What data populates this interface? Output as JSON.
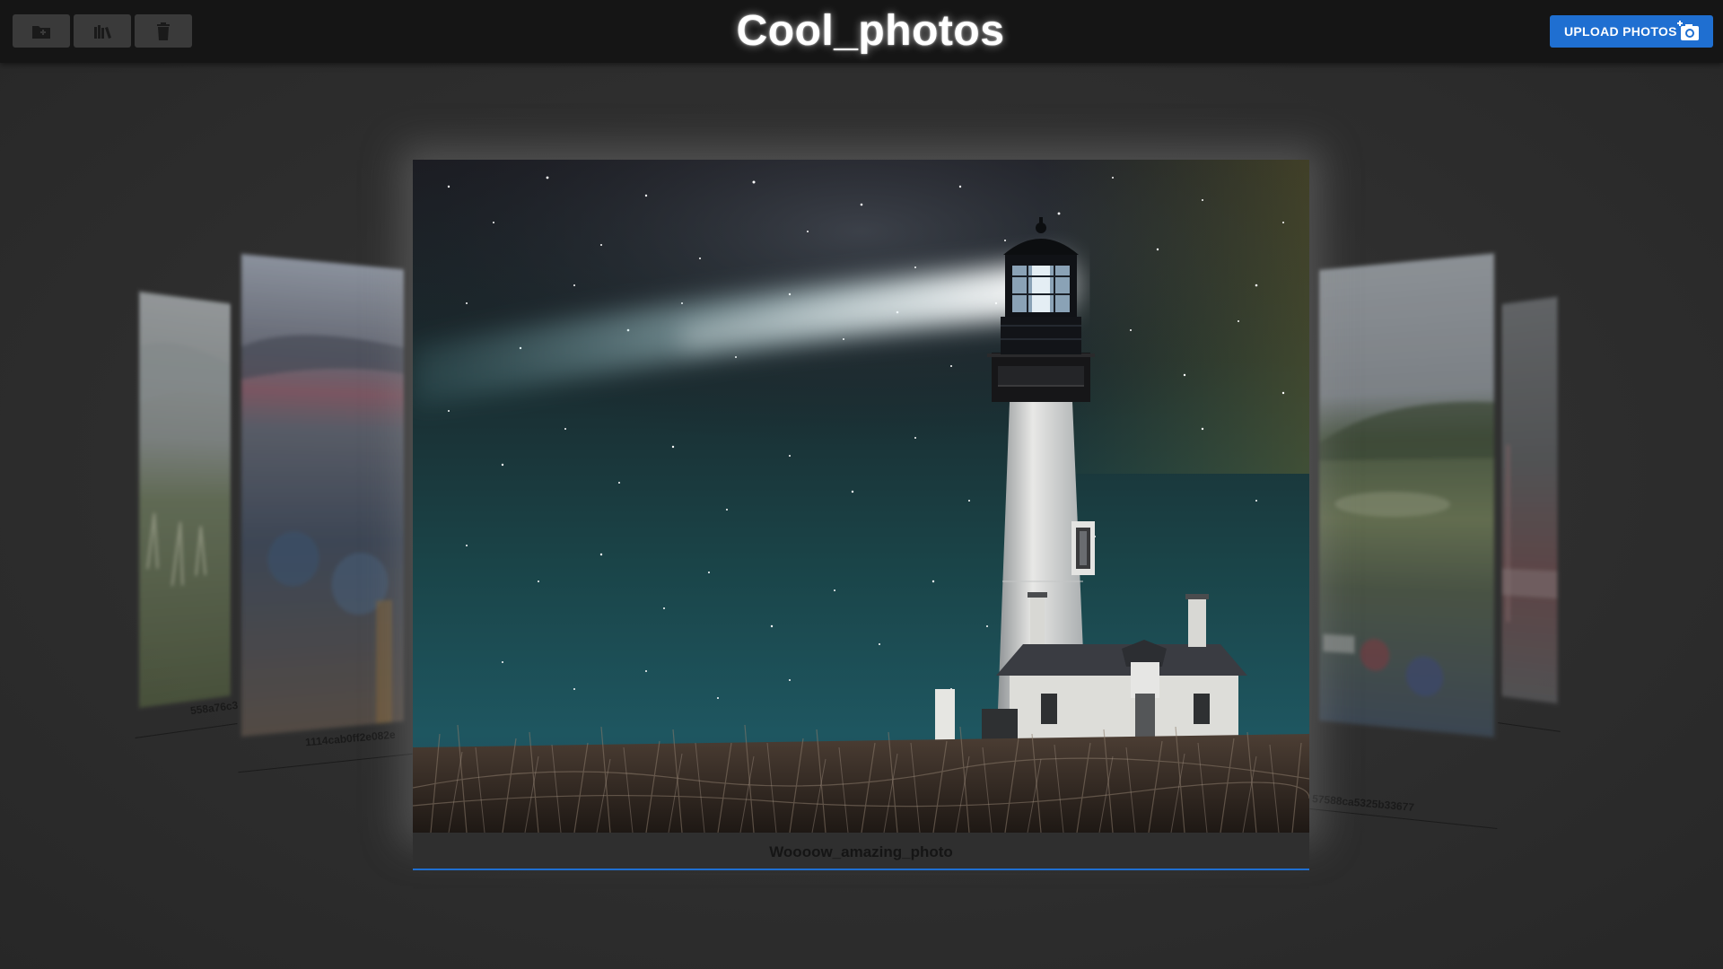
{
  "app": {
    "title": "Cool_photos"
  },
  "toolbar": {
    "buttons": [
      {
        "icon": "new-folder-icon"
      },
      {
        "icon": "library-icon"
      },
      {
        "icon": "delete-icon"
      }
    ],
    "upload_label": "UPLOAD PHOTOS",
    "upload_icon": "add-photo-icon"
  },
  "carousel": {
    "current": {
      "caption": "Woooow_amazing_photo"
    },
    "left": [
      {
        "caption": "558a76c3"
      },
      {
        "caption": "1114cab0ff2e082e"
      }
    ],
    "right": [
      {
        "caption": "57588ca5325b33677"
      },
      {
        "caption": ""
      }
    ]
  },
  "colors": {
    "topbar": "#151515",
    "accent": "#1f6fd1",
    "background": "#2c2c2c"
  }
}
